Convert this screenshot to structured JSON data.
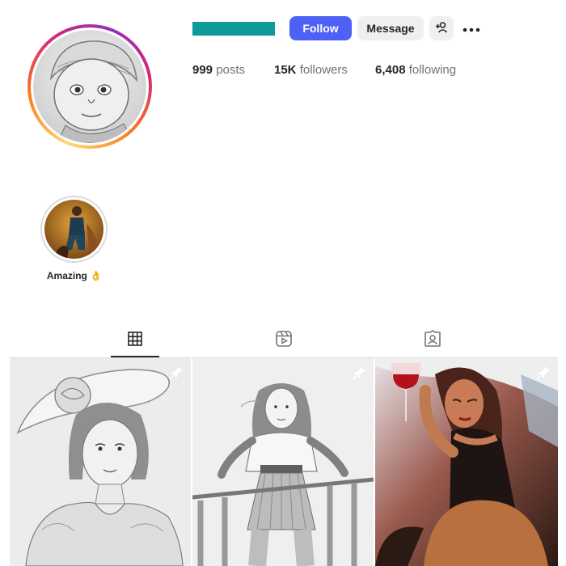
{
  "profile": {
    "follow_label": "Follow",
    "message_label": "Message",
    "add_user_icon": "add-user-icon",
    "more_icon": "more-options-icon",
    "username_color": "#0e9a9a",
    "accent_color": "#4e61f6"
  },
  "stats": {
    "posts_count": "999",
    "posts_label": "posts",
    "followers_count": "15K",
    "followers_label": "followers",
    "following_count": "6,408",
    "following_label": "following"
  },
  "highlights": [
    {
      "label": "Amazing 👌"
    }
  ],
  "tabs": [
    {
      "icon": "grid-icon",
      "active": true
    },
    {
      "icon": "reels-icon",
      "active": false
    },
    {
      "icon": "tagged-icon",
      "active": false
    }
  ],
  "posts": [
    {
      "image": "pencil sketch woman with hat",
      "pinned": true
    },
    {
      "image": "pencil sketch woman on balcony",
      "pinned": true
    },
    {
      "image": "painting woman with red wine",
      "pinned": true
    }
  ]
}
